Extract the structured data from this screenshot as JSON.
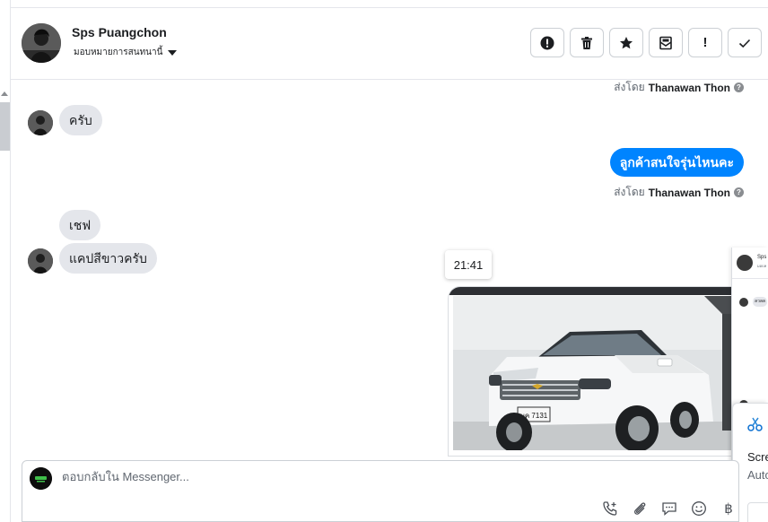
{
  "header": {
    "contact_name": "Sps Puangchon",
    "assign_label": "มอบหมายการสนทนานี้"
  },
  "actions": {
    "important": "!"
  },
  "messages": {
    "sent_by_label": "ส่งโดย",
    "sent_by_name": "Thanawan Thon",
    "in_1": "ครับ",
    "out_1": "ลูกค้าสนใจรุ่นไหนคะ",
    "in_2": "เชฟ",
    "in_3": "แคปสีขาวครับ",
    "time_tooltip": "21:41",
    "plate_text": "บค 7131"
  },
  "side_panel": {
    "name": "Sps",
    "sub": "มอบห",
    "mini_text": "ลวลล"
  },
  "screenshot_notice": {
    "title": "Scre",
    "subtitle": "Auto"
  },
  "composer": {
    "placeholder": "ตอบกลับใน Messenger...",
    "baht_symbol": "฿"
  },
  "colors": {
    "accent": "#0084ff",
    "incoming_bubble": "#e4e6eb",
    "border": "#ccd0d5"
  },
  "icons": [
    "alert-icon",
    "trash-icon",
    "star-icon",
    "mail-icon",
    "check-icon",
    "phone-plus-icon",
    "paperclip-icon",
    "chat-icon",
    "smile-icon",
    "baht-icon",
    "info-icon",
    "snipping-icon"
  ]
}
